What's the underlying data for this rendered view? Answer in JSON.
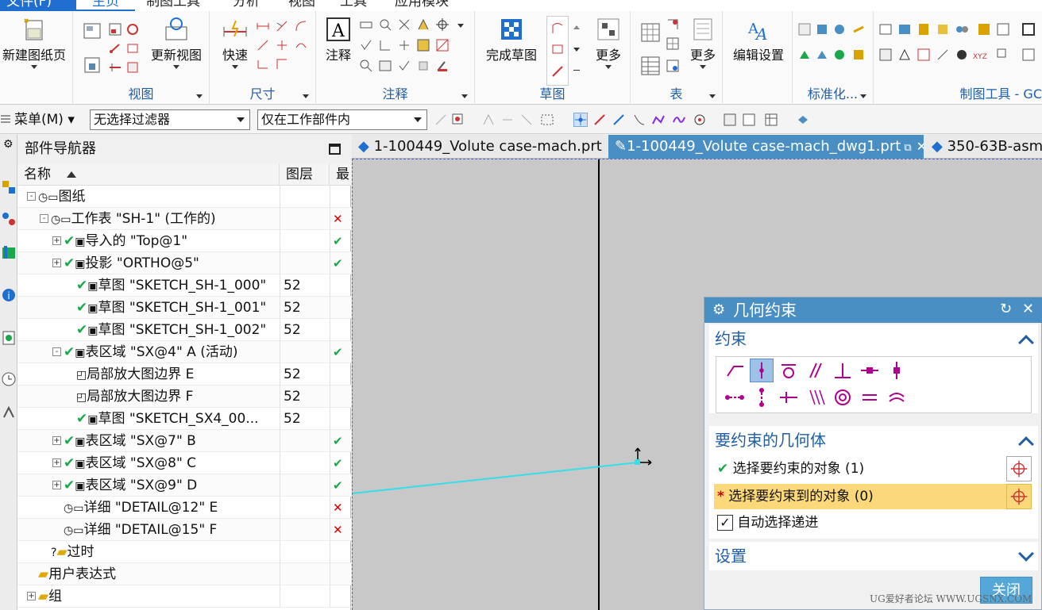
{
  "menu": {
    "file": "文件(F)",
    "tabs": [
      "主页",
      "制图工具",
      "分析",
      "视图",
      "工具",
      "应用模块"
    ]
  },
  "ribbon": {
    "new_sheet": "新建图纸页",
    "update_view": "更新视图",
    "quick": "快速",
    "note": "注释",
    "finish_sketch": "完成草图",
    "more1": "更多",
    "more2": "更多",
    "edit_settings": "编辑设置",
    "groups": {
      "view": "视图",
      "dimension": "尺寸",
      "annotation": "注释",
      "sketch": "草图",
      "table": "表",
      "standardize": "标准化...",
      "drafting_tools": "制图工具 - GC"
    }
  },
  "toolbar": {
    "menu": "菜单(M)",
    "filter": "无选择过滤器",
    "scope": "仅在工作部件内"
  },
  "navigator": {
    "title": "部件导航器",
    "col_name": "名称",
    "col_layer": "图层",
    "col_last": "最",
    "rows": [
      {
        "label": "图纸",
        "layer": "",
        "mark": ""
      },
      {
        "label": "工作表 \"SH-1\" (工作的)",
        "layer": "",
        "mark": "✕"
      },
      {
        "label": "导入的 \"Top@1\"",
        "layer": "",
        "mark": "✔"
      },
      {
        "label": "投影 \"ORTHO@5\"",
        "layer": "",
        "mark": "✔"
      },
      {
        "label": "草图 \"SKETCH_SH-1_000\"",
        "layer": "52",
        "mark": ""
      },
      {
        "label": "草图 \"SKETCH_SH-1_001\"",
        "layer": "52",
        "mark": ""
      },
      {
        "label": "草图 \"SKETCH_SH-1_002\"",
        "layer": "52",
        "mark": ""
      },
      {
        "label": "表区域 \"SX@4\" A (活动)",
        "layer": "",
        "mark": "✔"
      },
      {
        "label": "局部放大图边界 E",
        "layer": "52",
        "mark": ""
      },
      {
        "label": "局部放大图边界 F",
        "layer": "52",
        "mark": ""
      },
      {
        "label": "草图 \"SKETCH_SX4_00...",
        "layer": "52",
        "mark": ""
      },
      {
        "label": "表区域 \"SX@7\" B",
        "layer": "",
        "mark": "✔"
      },
      {
        "label": "表区域 \"SX@8\" C",
        "layer": "",
        "mark": "✔"
      },
      {
        "label": "表区域 \"SX@9\" D",
        "layer": "",
        "mark": "✔"
      },
      {
        "label": "详细 \"DETAIL@12\" E",
        "layer": "",
        "mark": "✕"
      },
      {
        "label": "详细 \"DETAIL@15\" F",
        "layer": "",
        "mark": "✕"
      },
      {
        "label": "过时",
        "layer": "",
        "mark": ""
      },
      {
        "label": "用户表达式",
        "layer": "",
        "mark": ""
      },
      {
        "label": "组",
        "layer": "",
        "mark": ""
      }
    ]
  },
  "doc_tabs": [
    "1-100449_Volute case-mach.prt",
    "1-100449_Volute case-mach_dwg1.prt",
    "350-63B-asm."
  ],
  "dialog": {
    "title": "几何约束",
    "section_constraint": "约束",
    "section_geometry": "要约束的几何体",
    "select_object": "选择要约束的对象 (1)",
    "select_target": "选择要约束到的对象 (0)",
    "auto_select": "自动选择递进",
    "section_settings": "设置",
    "close": "关闭"
  },
  "watermark": "UG爱好者论坛 WWW.UGSNX.COM",
  "colors": {
    "accent": "#4a8fc4",
    "highlight": "#fbd97a",
    "sketch_line": "#33e0e8"
  }
}
